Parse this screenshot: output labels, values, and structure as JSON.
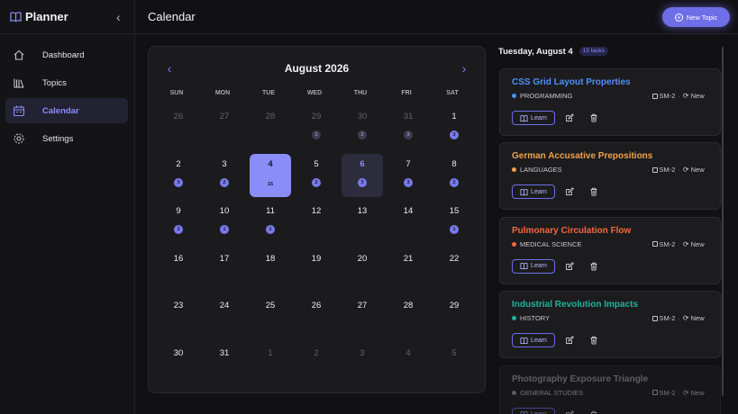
{
  "app": {
    "name": "Planner"
  },
  "sidebar": {
    "items": [
      {
        "label": "Dashboard",
        "icon": "home-icon",
        "active": false
      },
      {
        "label": "Topics",
        "icon": "books-icon",
        "active": false
      },
      {
        "label": "Calendar",
        "icon": "calendar-icon",
        "active": true
      },
      {
        "label": "Settings",
        "icon": "gear-icon",
        "active": false
      }
    ]
  },
  "header": {
    "title": "Calendar",
    "new_topic_label": "New Topic"
  },
  "calendar": {
    "month_label": "August 2026",
    "weekdays": [
      "SUN",
      "MON",
      "TUE",
      "WED",
      "THU",
      "FRI",
      "SAT"
    ],
    "today_count": "15",
    "weeks": [
      [
        {
          "d": "26",
          "m": true,
          "b": ""
        },
        {
          "d": "27",
          "m": true,
          "b": ""
        },
        {
          "d": "28",
          "m": true,
          "b": ""
        },
        {
          "d": "29",
          "m": true,
          "b": "1"
        },
        {
          "d": "30",
          "m": true,
          "b": "2"
        },
        {
          "d": "31",
          "m": true,
          "b": "3"
        },
        {
          "d": "1",
          "m": false,
          "b": "3"
        }
      ],
      [
        {
          "d": "2",
          "m": false,
          "b": "3"
        },
        {
          "d": "3",
          "m": false,
          "b": "2"
        },
        {
          "d": "4",
          "m": false,
          "b": "",
          "today": true
        },
        {
          "d": "5",
          "m": false,
          "b": "2"
        },
        {
          "d": "6",
          "m": false,
          "b": "3",
          "selected": true
        },
        {
          "d": "7",
          "m": false,
          "b": "3"
        },
        {
          "d": "8",
          "m": false,
          "b": "2"
        }
      ],
      [
        {
          "d": "9",
          "m": false,
          "b": "2"
        },
        {
          "d": "10",
          "m": false,
          "b": "1"
        },
        {
          "d": "11",
          "m": false,
          "b": "1"
        },
        {
          "d": "12",
          "m": false,
          "b": ""
        },
        {
          "d": "13",
          "m": false,
          "b": ""
        },
        {
          "d": "14",
          "m": false,
          "b": ""
        },
        {
          "d": "15",
          "m": false,
          "b": "1"
        }
      ],
      [
        {
          "d": "16",
          "m": false,
          "b": ""
        },
        {
          "d": "17",
          "m": false,
          "b": ""
        },
        {
          "d": "18",
          "m": false,
          "b": ""
        },
        {
          "d": "19",
          "m": false,
          "b": ""
        },
        {
          "d": "20",
          "m": false,
          "b": ""
        },
        {
          "d": "21",
          "m": false,
          "b": ""
        },
        {
          "d": "22",
          "m": false,
          "b": ""
        }
      ],
      [
        {
          "d": "23",
          "m": false,
          "b": ""
        },
        {
          "d": "24",
          "m": false,
          "b": ""
        },
        {
          "d": "25",
          "m": false,
          "b": ""
        },
        {
          "d": "26",
          "m": false,
          "b": ""
        },
        {
          "d": "27",
          "m": false,
          "b": ""
        },
        {
          "d": "28",
          "m": false,
          "b": ""
        },
        {
          "d": "29",
          "m": false,
          "b": ""
        }
      ],
      [
        {
          "d": "30",
          "m": false,
          "b": ""
        },
        {
          "d": "31",
          "m": false,
          "b": ""
        },
        {
          "d": "1",
          "m": true,
          "b": ""
        },
        {
          "d": "2",
          "m": true,
          "b": ""
        },
        {
          "d": "3",
          "m": true,
          "b": ""
        },
        {
          "d": "4",
          "m": true,
          "b": ""
        },
        {
          "d": "5",
          "m": true,
          "b": ""
        }
      ]
    ]
  },
  "panel": {
    "date_label": "Tuesday, August 4",
    "count_label": "15 tasks",
    "learn_label": "Learn",
    "tasks": [
      {
        "title": "CSS Grid Layout Properties",
        "category": "PROGRAMMING",
        "color": "#4f8ff7",
        "stage": "SM-2",
        "status": "New"
      },
      {
        "title": "German Accusative Prepositions",
        "category": "LANGUAGES",
        "color": "#f2a14a",
        "stage": "SM-2",
        "status": "New"
      },
      {
        "title": "Pulmonary Circulation Flow",
        "category": "MEDICAL SCIENCE",
        "color": "#f2683f",
        "stage": "SM-2",
        "status": "New"
      },
      {
        "title": "Industrial Revolution Impacts",
        "category": "HISTORY",
        "color": "#20b39a",
        "stage": "SM-2",
        "status": "New"
      },
      {
        "title": "Photography Exposure Triangle",
        "category": "GENERAL STUDIES",
        "color": "#9a9aa2",
        "stage": "SM-2",
        "status": "New"
      }
    ]
  }
}
